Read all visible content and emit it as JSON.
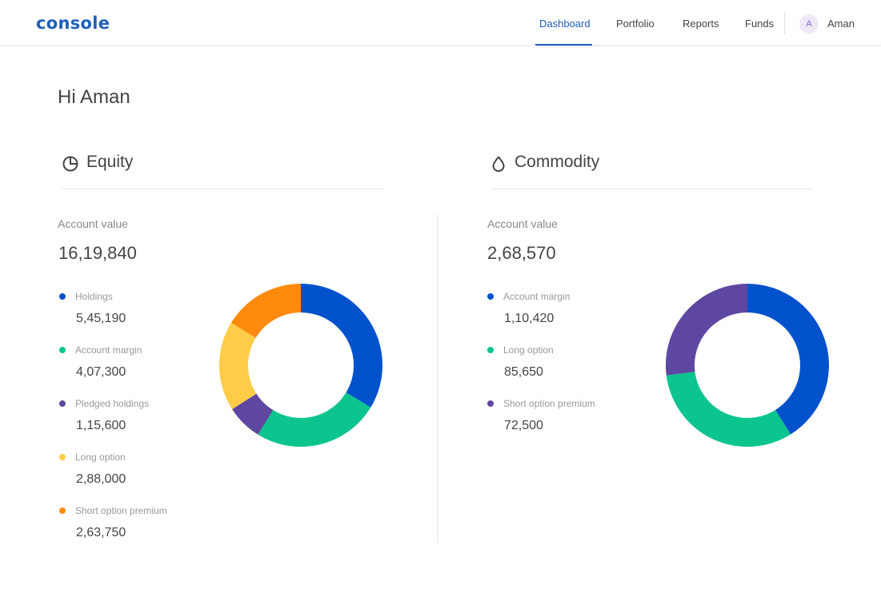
{
  "app": {
    "logo": "console"
  },
  "nav": {
    "items": [
      {
        "label": "Dashboard",
        "active": true
      },
      {
        "label": "Portfolio",
        "active": false
      },
      {
        "label": "Reports",
        "active": false
      },
      {
        "label": "Funds",
        "active": false
      }
    ],
    "user": {
      "initial": "A",
      "name": "Aman"
    }
  },
  "greeting": "Hi Aman",
  "equity": {
    "title": "Equity",
    "icon": "pie-chart-icon",
    "account_label": "Account value",
    "account_value": "16,19,840",
    "legend": [
      {
        "label": "Holdings",
        "value": "5,45,190",
        "color": "#0052cc"
      },
      {
        "label": "Account margin",
        "value": "4,07,300",
        "color": "#0cc48e"
      },
      {
        "label": "Pledged holdings",
        "value": "1,15,600",
        "color": "#5e47a0"
      },
      {
        "label": "Long option",
        "value": "2,88,000",
        "color": "#ffcc47"
      },
      {
        "label": "Short option premium",
        "value": "2,63,750",
        "color": "#ff8a0d"
      }
    ]
  },
  "commodity": {
    "title": "Commodity",
    "icon": "drop-icon",
    "account_label": "Account value",
    "account_value": "2,68,570",
    "legend": [
      {
        "label": "Account margin",
        "value": "1,10,420",
        "color": "#0052cc"
      },
      {
        "label": "Long option",
        "value": "85,650",
        "color": "#0cc48e"
      },
      {
        "label": "Short option premium",
        "value": "72,500",
        "color": "#5e47a0"
      }
    ]
  },
  "chart_data": [
    {
      "type": "pie",
      "donut": true,
      "categories": [
        "Holdings",
        "Account margin",
        "Pledged holdings",
        "Long option",
        "Short option premium"
      ],
      "values": [
        545190,
        407300,
        115600,
        288000,
        263750
      ],
      "colors": [
        "#0052cc",
        "#0cc48e",
        "#5e47a0",
        "#ffcc47",
        "#ff8a0d"
      ]
    },
    {
      "type": "pie",
      "donut": true,
      "categories": [
        "Account margin",
        "Long option",
        "Short option premium"
      ],
      "values": [
        110420,
        85650,
        72500
      ],
      "colors": [
        "#0052cc",
        "#0cc48e",
        "#5e47a0"
      ]
    }
  ]
}
